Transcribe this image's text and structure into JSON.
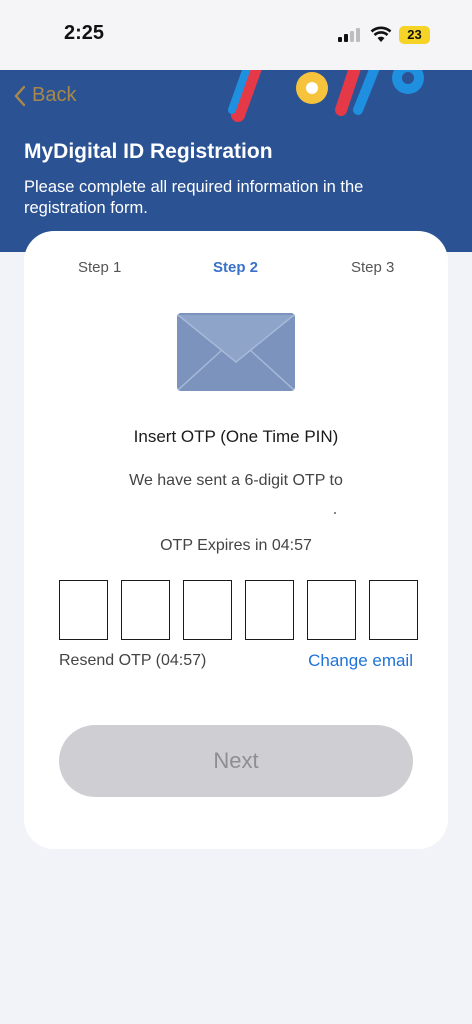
{
  "status_bar": {
    "time": "2:25",
    "battery": "23"
  },
  "header": {
    "back_label": "Back",
    "title": "MyDigital ID Registration",
    "subtitle": "Please complete all required information in the registration form."
  },
  "steps": [
    "Step 1",
    "Step 2",
    "Step 3"
  ],
  "otp": {
    "title": "Insert OTP (One Time PIN)",
    "sent_text": "We have sent a 6-digit OTP to",
    "expires_text": "OTP Expires in 04:57",
    "digits": [
      "",
      "",
      "",
      "",
      "",
      ""
    ],
    "resend_label": "Resend OTP (04:57)",
    "change_email_label": "Change email"
  },
  "next_label": "Next",
  "colors": {
    "header_bg": "#2b5394",
    "active_step": "#3a72c9",
    "link": "#1f73d6",
    "back": "#a9884a",
    "disabled_button": "#cfcfd3"
  }
}
